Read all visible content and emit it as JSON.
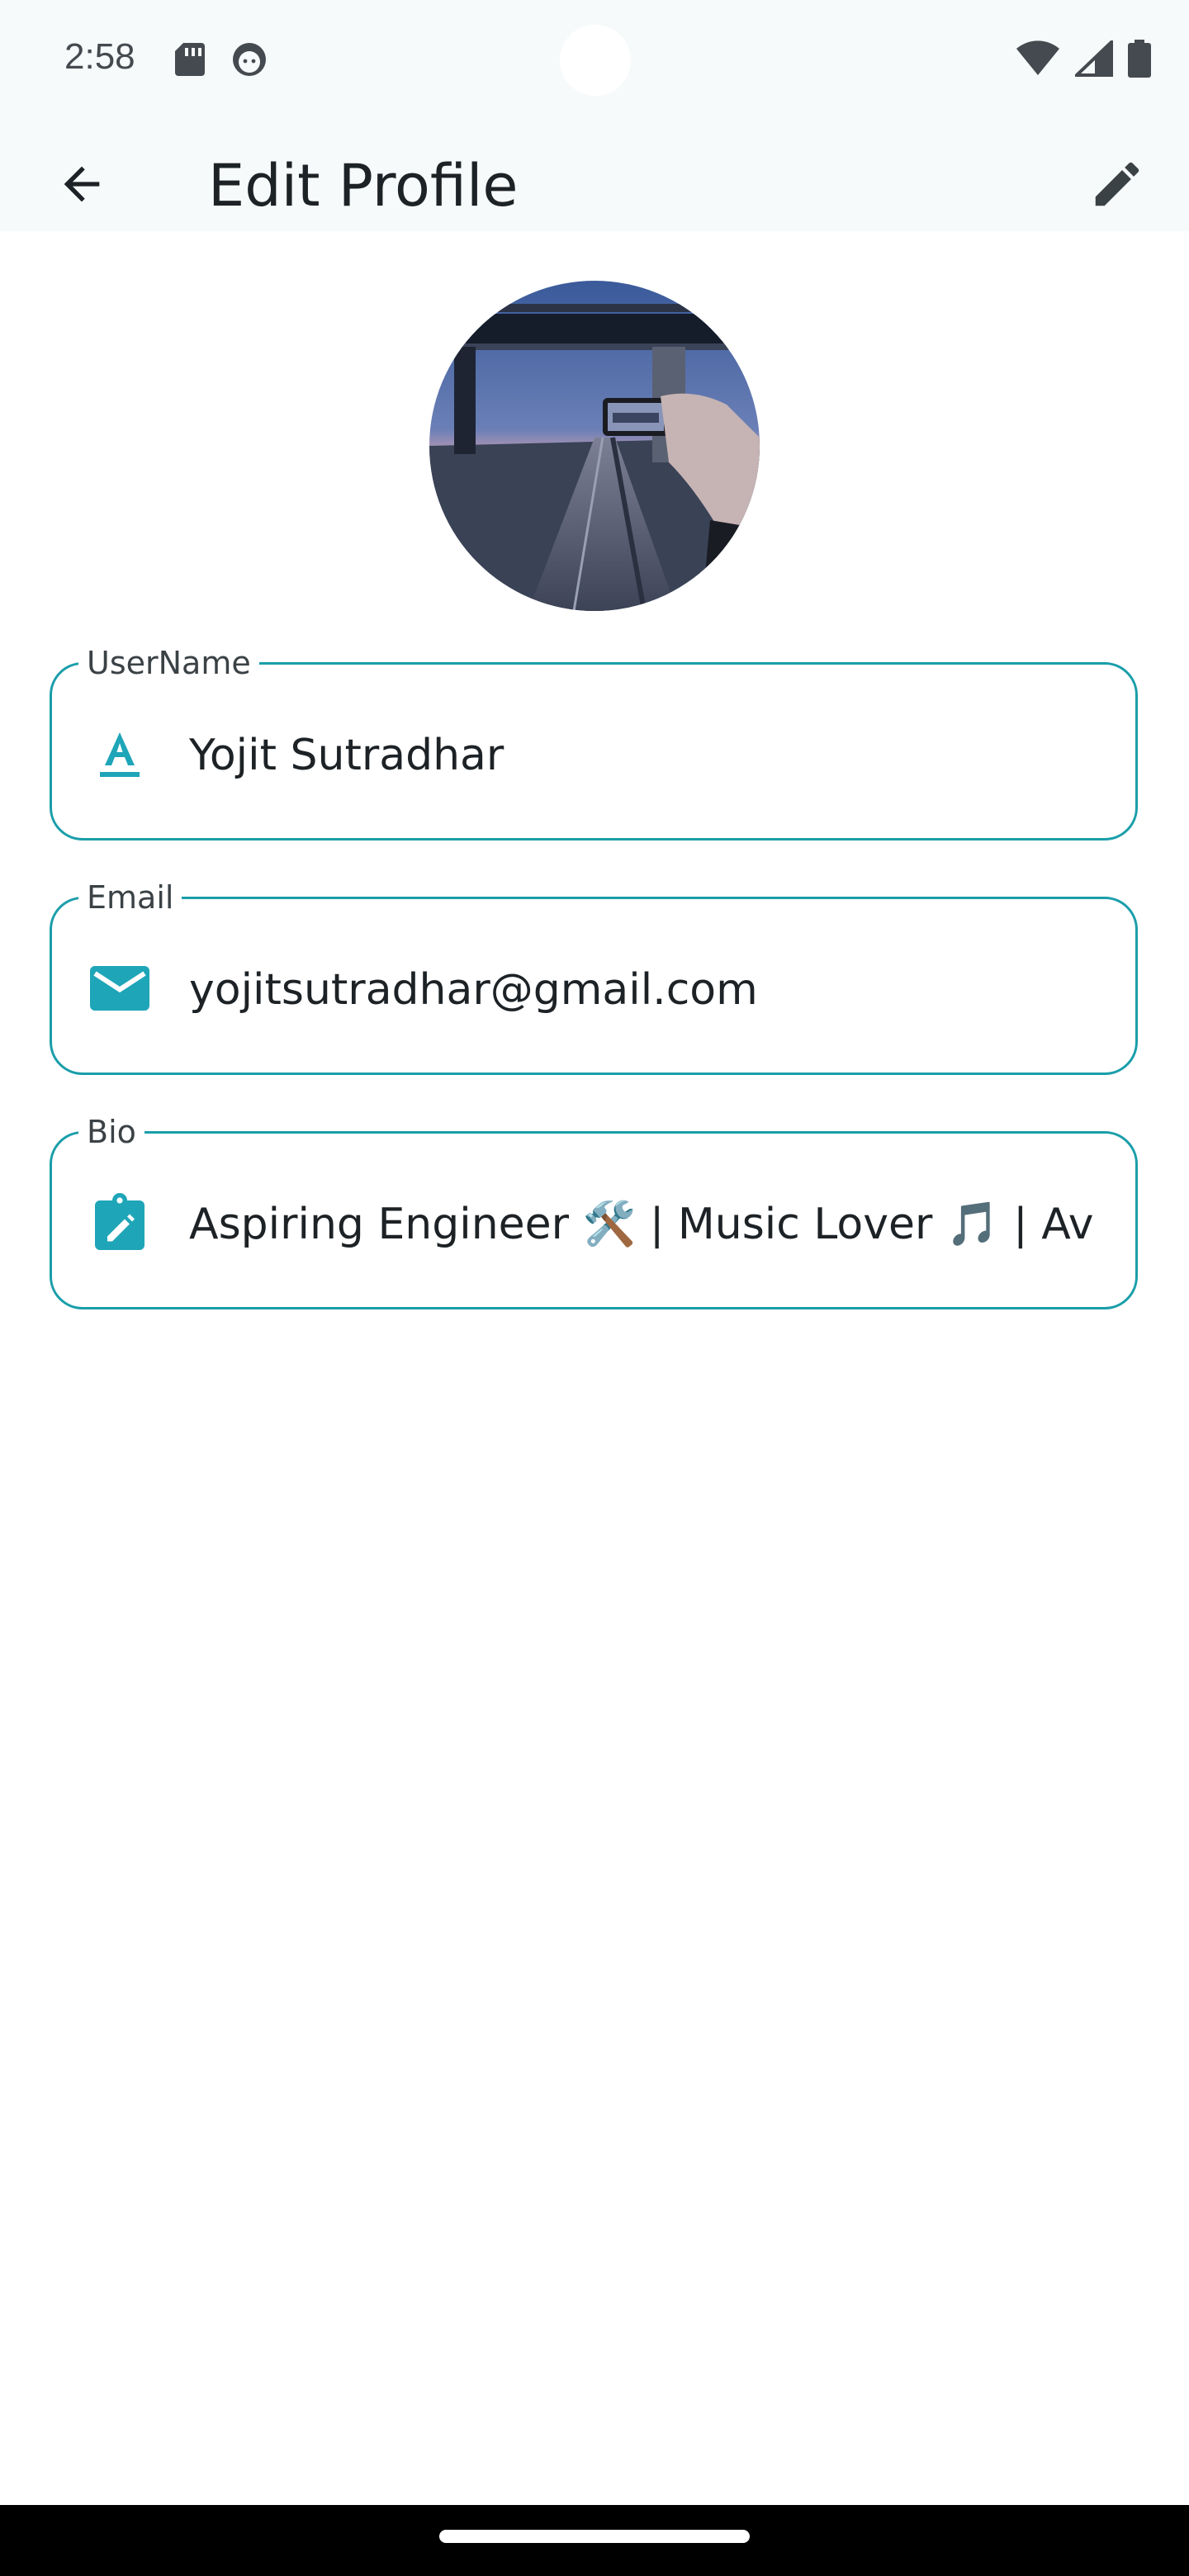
{
  "status_bar": {
    "time": "2:58",
    "icons": [
      "sd-card-icon",
      "face-icon",
      "wifi-icon",
      "signal-icon",
      "battery-icon"
    ]
  },
  "app_bar": {
    "title": "Edit Profile",
    "back_icon": "arrow-back-icon",
    "edit_icon": "pencil-icon"
  },
  "avatar": {
    "icon": "avatar-photo"
  },
  "fields": {
    "username": {
      "label": "UserName",
      "value": "Yojit Sutradhar",
      "icon": "text-format-icon"
    },
    "email": {
      "label": "Email",
      "value": "yojitsutradhar@gmail.com",
      "icon": "mail-icon"
    },
    "bio": {
      "label": "Bio",
      "value": "Aspiring Engineer 🛠️ | Music Lover 🎵 | Av",
      "icon": "edit-note-icon"
    }
  },
  "colors": {
    "accent": "#1a9eaa",
    "icon_teal": "#1ea5b8",
    "text": "#1d2226",
    "app_bar_bg": "#f7fafb"
  }
}
